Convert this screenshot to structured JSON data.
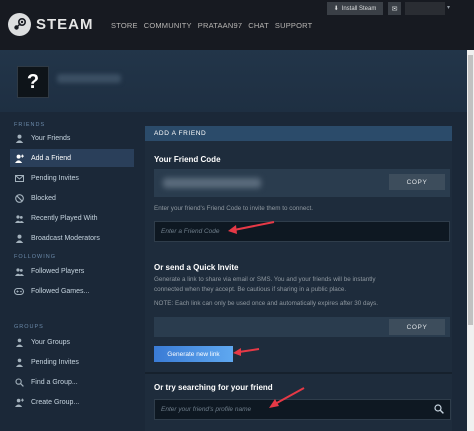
{
  "header": {
    "brand": "STEAM",
    "nav": [
      "STORE",
      "COMMUNITY",
      "PRATAAN97",
      "CHAT",
      "SUPPORT"
    ],
    "install_label": "Install Steam",
    "mail_icon": "envelope-icon"
  },
  "sidebar": {
    "friends_heading": "FRIENDS",
    "friends_items": [
      {
        "label": "Your Friends",
        "icon": "person-icon"
      },
      {
        "label": "Add a Friend",
        "icon": "add-person-icon"
      },
      {
        "label": "Pending Invites",
        "icon": "envelope-icon"
      },
      {
        "label": "Blocked",
        "icon": "blocked-icon"
      },
      {
        "label": "Recently Played With",
        "icon": "recent-icon"
      },
      {
        "label": "Broadcast Moderators",
        "icon": "moderator-icon"
      }
    ],
    "following_heading": "FOLLOWING",
    "following_items": [
      {
        "label": "Followed Players",
        "icon": "people-icon"
      },
      {
        "label": "Followed Games...",
        "icon": "gamepad-icon"
      }
    ],
    "groups_heading": "GROUPS",
    "groups_items": [
      {
        "label": "Your Groups",
        "icon": "group-icon"
      },
      {
        "label": "Pending Invites",
        "icon": "group-icon"
      },
      {
        "label": "Find a Group...",
        "icon": "search-icon"
      },
      {
        "label": "Create Group...",
        "icon": "create-group-icon"
      }
    ]
  },
  "main": {
    "header": "ADD A FRIEND",
    "friend_code": {
      "title": "Your Friend Code",
      "copy_label": "COPY",
      "hint": "Enter your friend's Friend Code to invite them to connect.",
      "input_placeholder": "Enter a Friend Code"
    },
    "quick_invite": {
      "title": "Or send a Quick Invite",
      "desc_lines": [
        "Generate a link to share via email or SMS. You and your friends will be instantly",
        "connected when they accept. Be cautious if sharing in a public place."
      ],
      "note": "NOTE: Each link can only be used once and automatically expires after 30 days.",
      "copy_label": "COPY",
      "generate_label": "Generate new link"
    },
    "search": {
      "title": "Or try searching for your friend",
      "input_placeholder": "Enter your friend's profile name"
    }
  },
  "colors": {
    "background": "#1b2838",
    "topbar": "#171a21",
    "panel_header": "#2b4b6a",
    "accent_button": "#3a7bd5",
    "arrow": "#e63946"
  }
}
